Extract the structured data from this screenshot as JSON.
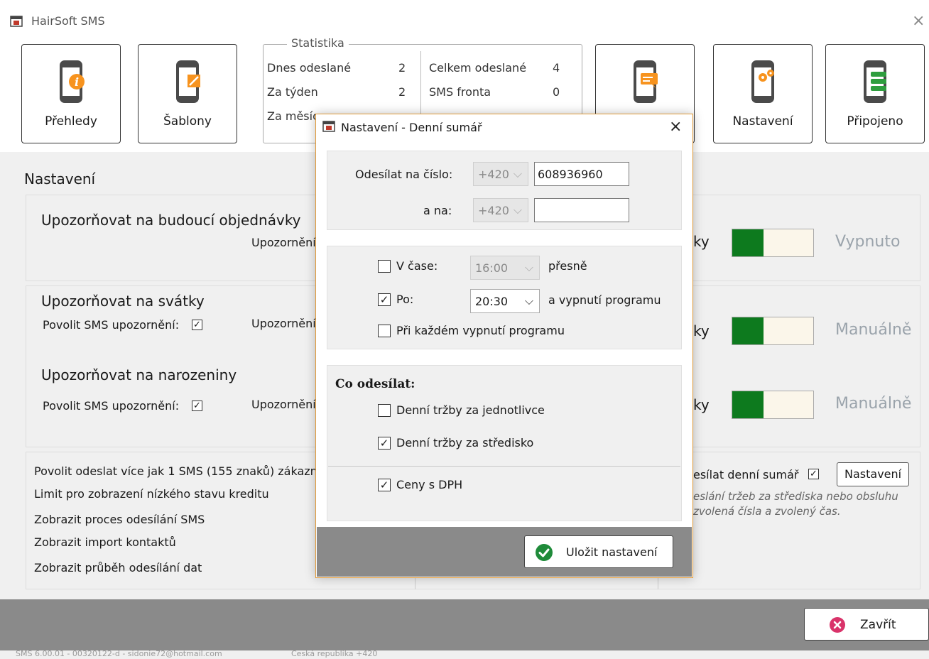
{
  "window": {
    "title": "HairSoft SMS",
    "close_glyph": "×",
    "icon": "app-window-icon"
  },
  "toolbar": {
    "buttons": [
      {
        "label": "Přehledy",
        "icon": "phone-info-icon"
      },
      {
        "label": "Šablony",
        "icon": "phone-edit-icon"
      },
      {
        "label": "",
        "icon": "phone-chat-icon"
      },
      {
        "label": "Nastavení",
        "icon": "phone-gears-icon"
      },
      {
        "label": "Připojeno",
        "icon": "phone-database-icon"
      }
    ],
    "accent": "#f7931e",
    "phone_color": "#4a4a4a"
  },
  "stats": {
    "legend": "Statistika",
    "left": [
      {
        "label": "Dnes odeslané",
        "value": "2"
      },
      {
        "label": "Za týden",
        "value": "2"
      },
      {
        "label": "Za měsíc",
        "value": ""
      }
    ],
    "right": [
      {
        "label": "Celkem odeslané",
        "value": "4"
      },
      {
        "label": "SMS fronta",
        "value": "0"
      }
    ]
  },
  "main": {
    "title": "Nastavení",
    "upcoming": {
      "title": "Upozorňovat na budoucí objednávky",
      "upoz": "Upozornění",
      "tail": "ky",
      "state": "Vypnuto"
    },
    "holidays": {
      "title": "Upozorňovat na svátky",
      "allow": "Povolit SMS upozornění:",
      "upoz": "Upozornění",
      "tail": "ky",
      "state": "Manuálně"
    },
    "birthdays": {
      "title": "Upozorňovat na narozeniny",
      "allow": "Povolit SMS upozornění:",
      "upoz": "Upozornění",
      "tail": "ky",
      "state": "Manuálně"
    },
    "options": [
      "Povolit odeslat více jak 1 SMS (155 znaků) zákazník",
      "Limit pro zobrazení nízkého stavu kreditu",
      "Zobrazit proces odesílání SMS",
      "Zobrazit import kontaktů",
      "Zobrazit průběh odesílání dat"
    ],
    "summary": {
      "label": "esílat denní sumář",
      "button": "Nastavení",
      "note1": "eslání tržeb za střediska nebo obsluhu",
      "note2": "zvolená čísla a zvolený čas."
    },
    "check_glyph": "✓",
    "toggle_on_color": "#0d7a1e"
  },
  "footer": {
    "close_button": "Zavřít",
    "close_icon": "close-circle-icon",
    "close_color": "#d9336a"
  },
  "status": {
    "left": "SMS 6.00.01 - 00320122-d - sidonie72@hotmail.com",
    "right": "Česká republika +420"
  },
  "dialog": {
    "title": "Nastavení - Denní sumář",
    "close_glyph": "×",
    "send_to_label": "Odesílat na číslo:",
    "prefix1": "+420",
    "number1": "608936960",
    "and_to_label": "a na:",
    "prefix2": "+420",
    "number2": "",
    "v_case_label": "V čase:",
    "v_case_value": "16:00",
    "v_case_suffix": "přesně",
    "po_label": "Po:",
    "po_value": "20:30",
    "po_suffix": "a vypnutí programu",
    "each_exit_label": "Při každém vypnutí programu",
    "what_label": "Co odesílat:",
    "daily_individuals": "Denní tržby za jednotlivce",
    "daily_center": "Denní tržby za středisko",
    "vat_label": "Ceny s DPH",
    "save_button": "Uložit nastavení",
    "save_icon_color": "#1f8b3a",
    "arrow_glyph": "⌵"
  }
}
